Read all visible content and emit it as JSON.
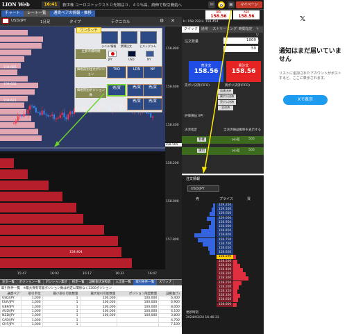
{
  "topbar": {
    "logo": "LION Web",
    "time": "16:41",
    "ticker": "救世株  ユーロストックス５０先物は０．４０％高、続伸で取引開始へ",
    "mypage": "マイページ"
  },
  "chart": {
    "tabs": [
      "チャート",
      "レート一覧",
      "通貨ペアの情報・推移"
    ],
    "symbol": "USD/JPY",
    "interval": "1分足",
    "type_label": "タイプ",
    "tech_label": "テクニカル",
    "oneclick": "ワンタッチ",
    "popup": {
      "icons": [
        "ラベル/情報",
        "累積注文",
        "ヒストグラム"
      ],
      "flags": [
        "JPY",
        "USD",
        "NY"
      ],
      "rows": [
        {
          "label": "主要市場時間",
          "btns": []
        },
        {
          "label": "価格帯別注文ポジション",
          "btns": [
            "TKO",
            "LDN",
            "NY"
          ]
        },
        {
          "label": "価格帯別ポジション数",
          "btns": [
            "売/買",
            "売/買",
            "売/買"
          ]
        }
      ]
    },
    "prices_left": [
      "158.685",
      "158.632",
      "158.621",
      "158.404"
    ],
    "current": "158.565",
    "yticks": [
      "158.800",
      "158.600",
      "158.400",
      "158.200",
      "158.000",
      "157.800"
    ],
    "xticks": [
      "15:47",
      "16:02",
      "16:17",
      "16:32",
      "16:47"
    ]
  },
  "table": {
    "tabs": [
      "注文一覧",
      "ポジション一覧",
      "ポジション集計",
      "約定一覧",
      "証拠金状況照会",
      "入出金一覧",
      "取引条件一覧",
      "スワップ"
    ],
    "title": "取引条件一覧　※最大保有可能ポジション数は約定に関係なく1300ポジション",
    "headers": [
      "通貨ペア",
      "取引単位",
      "最小取引可能数量",
      "最大取引可能数量",
      "ポジション限度数量",
      "証拠金(5)"
    ],
    "rows": [
      [
        "USD/JPY",
        "1,000",
        "1",
        "100,000",
        "100,000",
        "6,400"
      ],
      [
        "EUR/JPY",
        "1,000",
        "1",
        "100,000",
        "100,000",
        "6,900"
      ],
      [
        "GBP/JPY",
        "1,000",
        "1",
        "100,000",
        "100,000",
        "8,000"
      ],
      [
        "AUD/JPY",
        "1,000",
        "1",
        "100,000",
        "100,000",
        "4,100"
      ],
      [
        "NZD/JPY",
        "1,000",
        "1",
        "100,000",
        "100,000",
        "3,800"
      ],
      [
        "CAD/JPY",
        "1,000",
        "1",
        "",
        "",
        "4,700"
      ],
      [
        "CHF/JPY",
        "1,000",
        "1",
        "",
        "",
        "7,100"
      ]
    ]
  },
  "right": {
    "bid_label": "BID",
    "ask_label": "ASK",
    "bid": "158.56",
    "ask": "158.56",
    "hl": "H: 158.793  L: 158.454",
    "tabs": [
      "クイック",
      "通常",
      "ストリーミング",
      "時間指定",
      "トリガー"
    ],
    "qty": "1000",
    "slip": "50",
    "sell_label": "売注文",
    "buy_label": "買注文",
    "sell_price": "158.56",
    "buy_price": "158.56",
    "settle": [
      "売ポジ決済(FIFO)",
      "買ポジ決済(FIFO)"
    ],
    "settle2": [
      "両建決済",
      "買ポジ決済",
      "売ポジ決済",
      "全決済"
    ],
    "eval": "評価損益 0円",
    "stop_label": "決済指定",
    "check_label": "全決済損益推移を表示する",
    "rows": [
      {
        "label": "利確",
        "pip": "pip差",
        "val": "500"
      },
      {
        "label": "損切",
        "pip": "pip差",
        "val": "500"
      }
    ]
  },
  "board": {
    "title": "注文情報",
    "symbol": "USD/JPY",
    "col_sell": "売",
    "col_price": "プライス",
    "col_buy": "買",
    "prices": [
      "159.250",
      "159.100",
      "159.050",
      "159.000",
      "158.950",
      "158.900",
      "158.850",
      "158.800",
      "158.750",
      "158.700",
      "158.650",
      "158.600",
      "158.550",
      "158.500",
      "158.450",
      "158.400",
      "158.350",
      "158.300",
      "158.250",
      "158.200",
      "158.150",
      "158.100",
      "158.050",
      "158.000"
    ],
    "cur": "158.590",
    "updated": "更新時刻",
    "date": "2024/03/24 16:46:33"
  },
  "side": {
    "title": "通知はまだ届いていません",
    "desc": "リストに追加されたアカウントがポストすると、ここに表示されます。",
    "btn": "Xで表示"
  }
}
